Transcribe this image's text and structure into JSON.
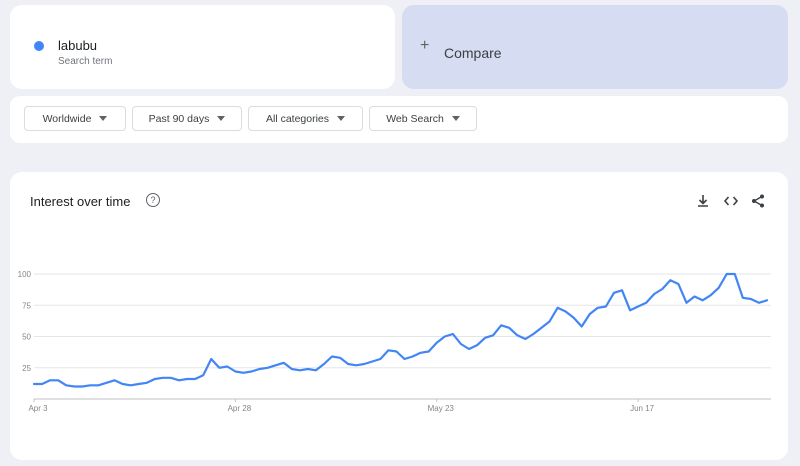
{
  "search_term": {
    "name": "labubu",
    "subtitle": "Search term",
    "color": "#4285f4"
  },
  "compare": {
    "plus": "+",
    "label": "Compare"
  },
  "filters": {
    "region": "Worldwide",
    "time_range": "Past 90 days",
    "category": "All categories",
    "search_type": "Web Search"
  },
  "panel": {
    "title": "Interest over time",
    "help": "?",
    "icons": [
      "download-icon",
      "embed-icon",
      "share-icon"
    ]
  },
  "chart_data": {
    "type": "line",
    "title": "",
    "xlabel": "",
    "ylabel": "",
    "ylim": [
      0,
      100
    ],
    "yticks": [
      25,
      50,
      75,
      100
    ],
    "grid": true,
    "x_tick_labels": [
      {
        "label": "Apr 3",
        "index": 0
      },
      {
        "label": "Apr 28",
        "index": 25
      },
      {
        "label": "May 23",
        "index": 50
      },
      {
        "label": "Jun 17",
        "index": 75
      }
    ],
    "series": [
      {
        "color": "#4285f4",
        "values": [
          12,
          12,
          15,
          15,
          11,
          10,
          10,
          11,
          11,
          13,
          15,
          12,
          11,
          12,
          13,
          16,
          17,
          17,
          15,
          16,
          16,
          19,
          32,
          25,
          26,
          22,
          21,
          22,
          24,
          25,
          27,
          29,
          24,
          23,
          24,
          23,
          28,
          34,
          33,
          28,
          27,
          28,
          30,
          32,
          39,
          38,
          32,
          34,
          37,
          38,
          45,
          50,
          52,
          44,
          40,
          43,
          49,
          51,
          59,
          57,
          51,
          48,
          52,
          57,
          62,
          73,
          70,
          65,
          58,
          68,
          73,
          74,
          85,
          87,
          71,
          74,
          77,
          84,
          88,
          95,
          92,
          77,
          82,
          79,
          83,
          89,
          100,
          100,
          81,
          80,
          77,
          79
        ]
      }
    ]
  }
}
